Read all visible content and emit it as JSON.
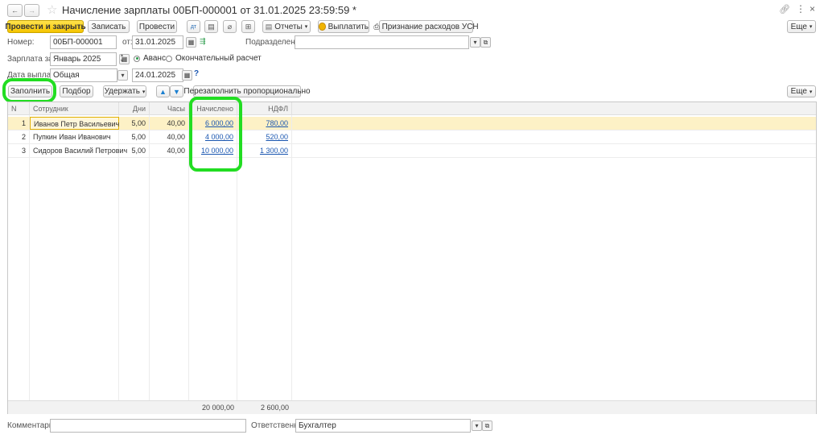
{
  "window": {
    "title": "Начисление зарплаты 00БП-000001 от 31.01.2025 23:59:59 *"
  },
  "toolbar": {
    "post_close": "Провести и закрыть",
    "save": "Записать",
    "post": "Провести",
    "reports": "Отчеты",
    "pay": "Выплатить",
    "usn": "Признание расходов УСН",
    "more": "Еще"
  },
  "header": {
    "number_label": "Номер:",
    "number": "00БП-000001",
    "date_label": "от:",
    "date": "31.01.2025",
    "division_label": "Подразделение:",
    "division": "",
    "salary_for_label": "Зарплата за:",
    "salary_for": "Январь 2025",
    "advance_label": "Аванс",
    "final_label": "Окончательный расчет",
    "pay_date_label": "Дата выплаты:",
    "pay_date_type": "Общая",
    "pay_date": "24.01.2025",
    "help": "?"
  },
  "table_toolbar": {
    "fill": "Заполнить",
    "pick": "Подбор",
    "withhold": "Удержать",
    "refill": "Перезаполнить пропорционально",
    "more": "Еще"
  },
  "table": {
    "columns": [
      "N",
      "Сотрудник",
      "Дни",
      "Часы",
      "Начислено",
      "НДФЛ"
    ],
    "rows": [
      {
        "n": "1",
        "employee": "Иванов Петр Васильевич",
        "days": "5,00",
        "hours": "40,00",
        "accrued": "6 000,00",
        "ndfl": "780,00"
      },
      {
        "n": "2",
        "employee": "Пупкин Иван Иванович",
        "days": "5,00",
        "hours": "40,00",
        "accrued": "4 000,00",
        "ndfl": "520,00"
      },
      {
        "n": "3",
        "employee": "Сидоров Василий Петрович",
        "days": "5,00",
        "hours": "40,00",
        "accrued": "10 000,00",
        "ndfl": "1 300,00"
      }
    ],
    "totals": {
      "accrued": "20 000,00",
      "ndfl": "2 600,00"
    }
  },
  "footer": {
    "comment_label": "Комментарий:",
    "comment": "",
    "responsible_label": "Ответственный:",
    "responsible": "Бухгалтер"
  },
  "colors": {
    "primary_button": "#f5c400",
    "selected_row": "#fdf1c6",
    "highlight": "#22dd22",
    "link": "#1a56b0"
  }
}
